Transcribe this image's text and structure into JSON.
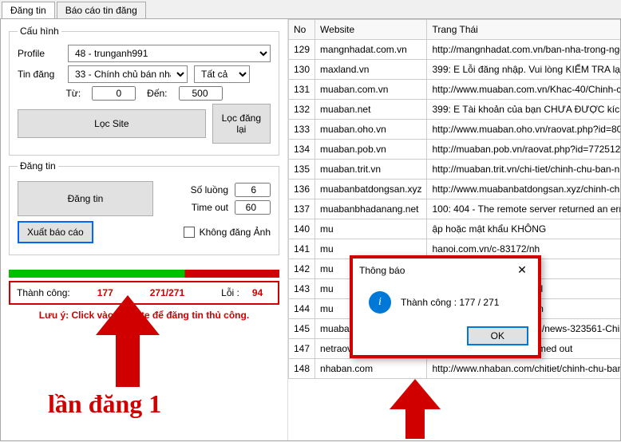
{
  "tabs": {
    "active": "Đăng tin",
    "inactive": "Báo cáo tin đăng"
  },
  "cfg": {
    "legend": "Cấu hình",
    "profile_lbl": "Profile",
    "profile_val": "48 - trunganh991",
    "tindang_lbl": "Tin đăng",
    "tindang_val": "33 - Chính chủ bán nhà",
    "filter_val": "Tất cả",
    "tu_lbl": "Từ:",
    "tu_val": "0",
    "den_lbl": "Đến:",
    "den_val": "500",
    "loc_site": "Lọc Site",
    "loc_lai": "Lọc đăng lại"
  },
  "post": {
    "legend": "Đăng tin",
    "btn": "Đăng tin",
    "soluong_lbl": "Số luồng",
    "soluong_val": "6",
    "timeout_lbl": "Time out",
    "timeout_val": "60",
    "xuat": "Xuất báo cáo",
    "kda": "Không đăng Ảnh"
  },
  "stats": {
    "tc_lbl": "Thành công:",
    "tc_val": "177",
    "progress": "271/271",
    "loi_lbl": "Lỗi :",
    "loi_val": "94",
    "note": "Lưu ý: Click vào tên site để đăng tin thủ công."
  },
  "annot": {
    "big": "lần đăng 1"
  },
  "dlg": {
    "title": "Thông báo",
    "msg": "Thành công : 177 / 271",
    "ok": "OK"
  },
  "table": {
    "h_no": "No",
    "h_site": "Website",
    "h_status": "Trang Thái",
    "rows": [
      {
        "no": "129",
        "site": "mangnhadat.com.vn",
        "st": "http://mangnhadat.com.vn/ban-nha-trong-ngo-n"
      },
      {
        "no": "130",
        "site": "maxland.vn",
        "st": "399: E Lỗi đăng nhập. Vui lòng KIỂM TRA lại trê"
      },
      {
        "no": "131",
        "site": "muaban.com.vn",
        "st": "http://www.muaban.com.vn/Khac-40/Chinh-chu-"
      },
      {
        "no": "132",
        "site": "muaban.net",
        "st": "399: E Tài khoản của bạn CHƯA ĐƯỢC kích ho"
      },
      {
        "no": "133",
        "site": "muaban.oho.vn",
        "st": "http://www.muaban.oho.vn/raovat.php?id=804"
      },
      {
        "no": "134",
        "site": "muaban.pob.vn",
        "st": "http://muaban.pob.vn/raovat.php?id=772512"
      },
      {
        "no": "135",
        "site": "muaban.trit.vn",
        "st": "http://muaban.trit.vn/chi-tiet/chinh-chu-ban-nha"
      },
      {
        "no": "136",
        "site": "muabanbatdongsan.xyz",
        "st": "http://www.muabanbatdongsan.xyz/chinh-chu-t"
      },
      {
        "no": "137",
        "site": "muabanbhadanang.net",
        "st": "100: 404 - The remote server returned an error: ("
      },
      {
        "no": "140",
        "site": "mu",
        "st": "ập hoặc mật khẩu KHÔNG"
      },
      {
        "no": "141",
        "site": "mu",
        "st": "hanoi.com.vn/c-83172/nh"
      },
      {
        "no": "142",
        "site": "mu",
        "st": "p. Vui lòng KIỂM TRA lại."
      },
      {
        "no": "143",
        "site": "mu",
        "st": ".com/mua-ban/4163024/cl"
      },
      {
        "no": "144",
        "site": "mu",
        "st": "huong.vn/chinh-chu-ban-n"
      },
      {
        "no": "145",
        "site": "muabansieutoc.com",
        "st": "http://muabansieutoc.com/news-323561-Chinh"
      },
      {
        "no": "147",
        "site": "netraovat.vn",
        "st": "100: The operation has timed out"
      },
      {
        "no": "148",
        "site": "nhaban.com",
        "st": "http://www.nhaban.com/chitiet/chinh-chu-ban-n"
      }
    ]
  }
}
